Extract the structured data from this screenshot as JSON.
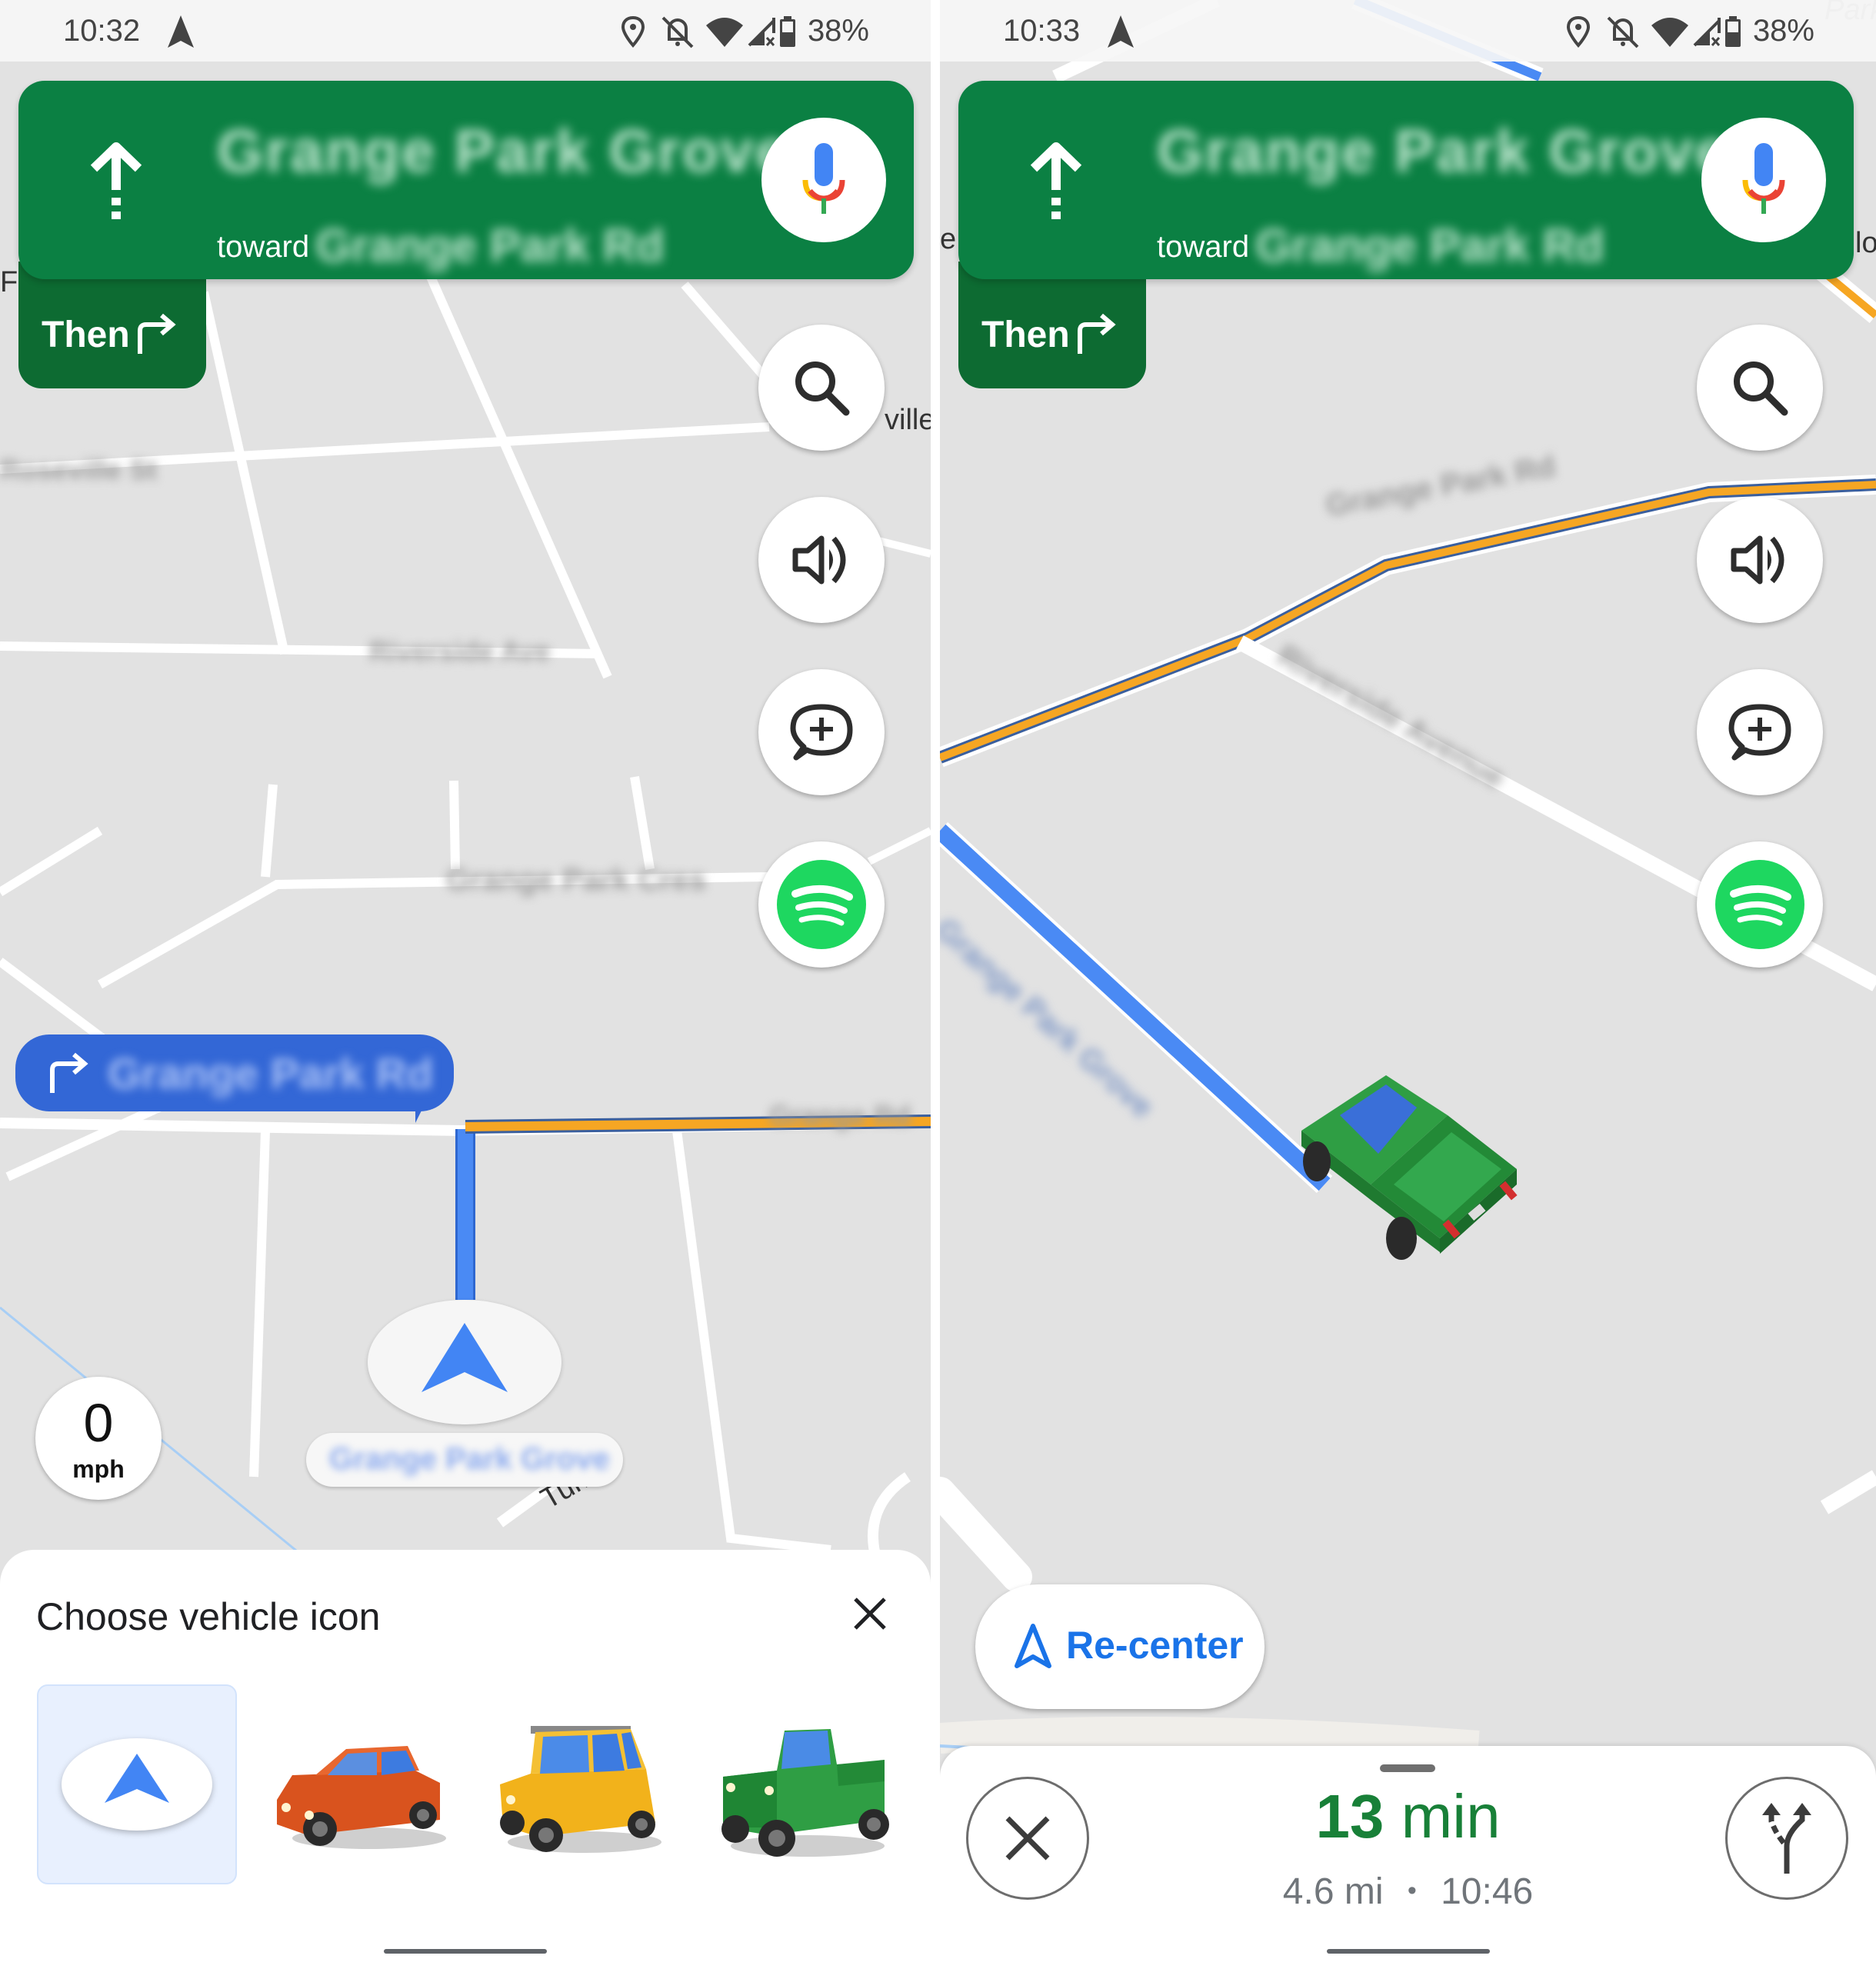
{
  "left_screen": {
    "status_bar": {
      "time": "10:32",
      "icons": [
        "navigation-arrow-icon",
        "location-pin-icon",
        "bell-off-icon",
        "wifi-icon",
        "signal-no-service-icon",
        "battery-icon"
      ],
      "battery_percent": "38%"
    },
    "nav_banner": {
      "maneuver_icon": "straight-arrow-icon",
      "street_name": "Grange Park Grove",
      "toward_prefix": "toward",
      "toward_destination": "Grange Park Rd",
      "mic_icon": "google-mic-icon"
    },
    "then_tab": {
      "label": "Then",
      "icon": "turn-right-icon"
    },
    "fab_buttons": [
      {
        "name": "search",
        "icon": "search-icon"
      },
      {
        "name": "sound",
        "icon": "volume-icon"
      },
      {
        "name": "report",
        "icon": "add-report-icon"
      },
      {
        "name": "spotify",
        "icon": "spotify-icon"
      }
    ],
    "turn_callout": {
      "icon": "turn-right-icon",
      "street": "Grange Park Rd"
    },
    "current_street": "Grange Park Grove",
    "map_labels": [
      "Fe",
      "Tumbl",
      "ville"
    ],
    "speed": {
      "value": "0",
      "unit": "mph"
    },
    "vehicle_sheet": {
      "title": "Choose vehicle icon",
      "close_icon": "close-icon",
      "options": [
        {
          "name": "navigation-arrow",
          "selected": true
        },
        {
          "name": "red-sedan",
          "selected": false,
          "color": "#e0562a"
        },
        {
          "name": "yellow-suv",
          "selected": false,
          "color": "#f4b400"
        },
        {
          "name": "green-pickup",
          "selected": false,
          "color": "#2f9e44"
        }
      ]
    }
  },
  "right_screen": {
    "status_bar": {
      "time": "10:33",
      "battery_percent": "38%"
    },
    "nav_banner": {
      "street_name": "Grange Park Grove",
      "toward_prefix": "toward",
      "toward_destination": "Grange Park Rd"
    },
    "then_tab": {
      "label": "Then"
    },
    "map_labels": [
      "Park",
      "lo",
      "e"
    ],
    "vehicle": "green-pickup",
    "recenter": {
      "label": "Re-center",
      "icon": "navigation-outline-icon"
    },
    "trip": {
      "duration_value": "13",
      "duration_unit": "min",
      "distance": "4.6 mi",
      "separator": "•",
      "arrival_time": "10:46"
    },
    "close_icon": "close-icon",
    "alternate_routes_icon": "fork-routes-icon"
  },
  "colors": {
    "nav_green": "#0b8043",
    "then_green": "#0d6b32",
    "route_blue": "#4285f4",
    "traffic_orange": "#f6a623",
    "eta_green": "#188038",
    "recenter_blue": "#1a73e8",
    "spotify_green": "#1ed760",
    "map_bg": "#e2e2e2"
  }
}
